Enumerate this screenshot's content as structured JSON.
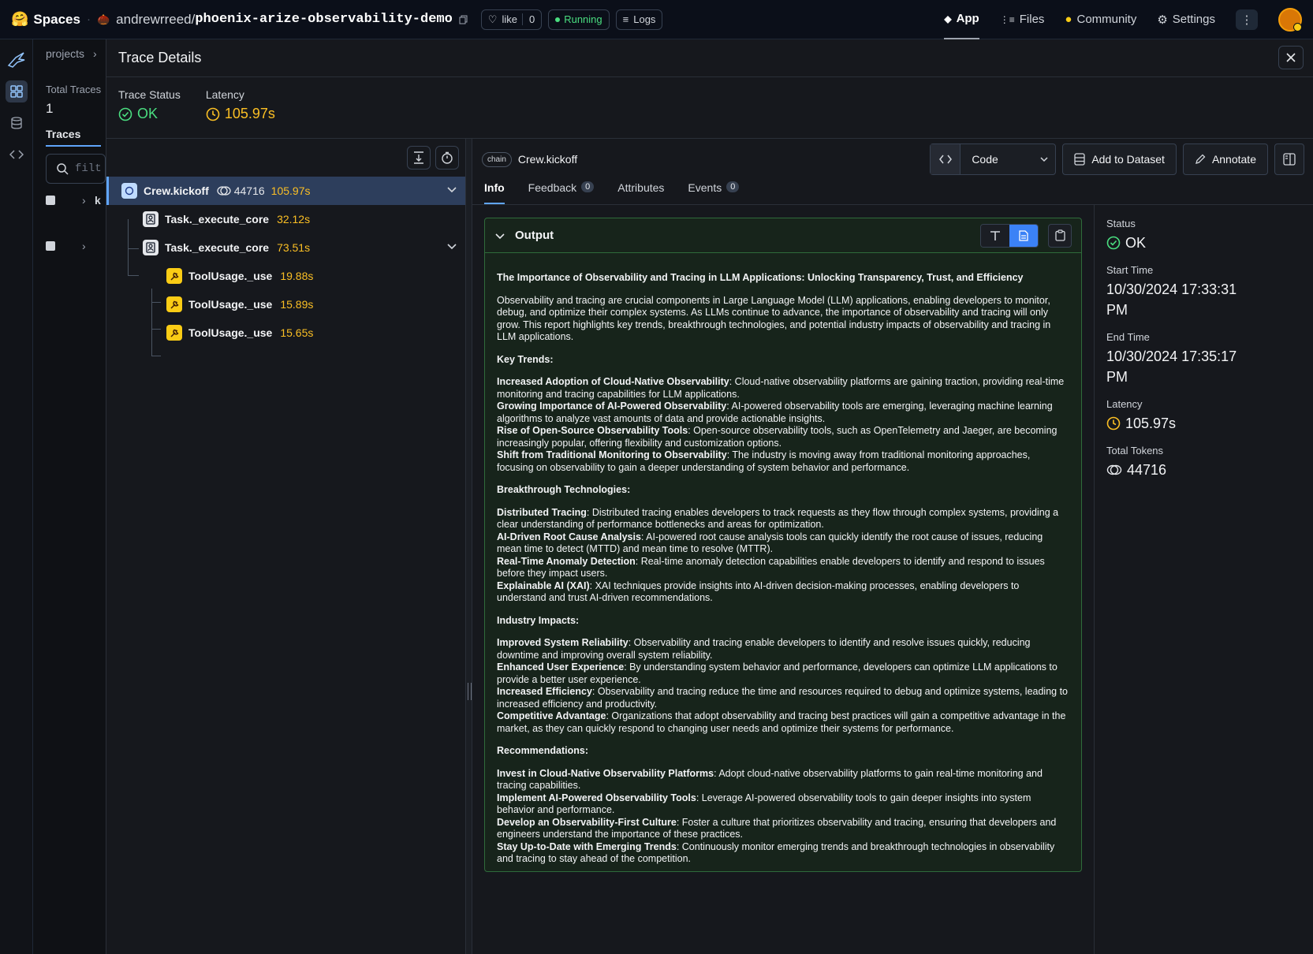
{
  "topbar": {
    "spaces_label": "Spaces",
    "repo_owner": "andrewrreed",
    "repo_slash": "/",
    "repo_name": "phoenix-arize-observability-demo",
    "like_label": "like",
    "like_count": "0",
    "status": "Running",
    "logs_label": "Logs",
    "nav": [
      "App",
      "Files",
      "Community",
      "Settings"
    ]
  },
  "bg": {
    "breadcrumb": "projects",
    "total_traces_label": "Total Traces",
    "total_traces_value": "1",
    "traces_tab": "Traces",
    "search_placeholder": "filt",
    "row_initial": "k"
  },
  "drawer": {
    "title": "Trace Details",
    "trace_status_label": "Trace Status",
    "trace_status_value": "OK",
    "latency_label": "Latency",
    "latency_value": "105.97s"
  },
  "tree": [
    {
      "name": "Crew.kickoff",
      "kind": "chain",
      "tokens": "44716",
      "latency": "105.97s"
    },
    {
      "name": "Task._execute_core",
      "kind": "agent",
      "latency": "32.12s"
    },
    {
      "name": "Task._execute_core",
      "kind": "agent",
      "latency": "73.51s"
    },
    {
      "name": "ToolUsage._use",
      "kind": "tool",
      "latency": "19.88s"
    },
    {
      "name": "ToolUsage._use",
      "kind": "tool",
      "latency": "15.89s"
    },
    {
      "name": "ToolUsage._use",
      "kind": "tool",
      "latency": "15.65s"
    }
  ],
  "span": {
    "badge": "chain",
    "name": "Crew.kickoff",
    "code_label": "Code",
    "add_dataset_label": "Add to Dataset",
    "annotate_label": "Annotate"
  },
  "tabs": [
    {
      "label": "Info"
    },
    {
      "label": "Feedback",
      "count": "0"
    },
    {
      "label": "Attributes"
    },
    {
      "label": "Events",
      "count": "0"
    }
  ],
  "output": {
    "title": "Output",
    "heading": "The Importance of Observability and Tracing in LLM Applications: Unlocking Transparency, Trust, and Efficiency",
    "intro": "Observability and tracing are crucial components in Large Language Model (LLM) applications, enabling developers to monitor, debug, and optimize their complex systems. As LLMs continue to advance, the importance of observability and tracing will only grow. This report highlights key trends, breakthrough technologies, and potential industry impacts of observability and tracing in LLM applications.",
    "sections": [
      {
        "title": "Key Trends:",
        "items": [
          {
            "b": "Increased Adoption of Cloud-Native Observability",
            "t": ": Cloud-native observability platforms are gaining traction, providing real-time monitoring and tracing capabilities for LLM applications."
          },
          {
            "b": "Growing Importance of AI-Powered Observability",
            "t": ": AI-powered observability tools are emerging, leveraging machine learning algorithms to analyze vast amounts of data and provide actionable insights."
          },
          {
            "b": "Rise of Open-Source Observability Tools",
            "t": ": Open-source observability tools, such as OpenTelemetry and Jaeger, are becoming increasingly popular, offering flexibility and customization options."
          },
          {
            "b": "Shift from Traditional Monitoring to Observability",
            "t": ": The industry is moving away from traditional monitoring approaches, focusing on observability to gain a deeper understanding of system behavior and performance."
          }
        ]
      },
      {
        "title": "Breakthrough Technologies:",
        "items": [
          {
            "b": "Distributed Tracing",
            "t": ": Distributed tracing enables developers to track requests as they flow through complex systems, providing a clear understanding of performance bottlenecks and areas for optimization."
          },
          {
            "b": "AI-Driven Root Cause Analysis",
            "t": ": AI-powered root cause analysis tools can quickly identify the root cause of issues, reducing mean time to detect (MTTD) and mean time to resolve (MTTR)."
          },
          {
            "b": "Real-Time Anomaly Detection",
            "t": ": Real-time anomaly detection capabilities enable developers to identify and respond to issues before they impact users."
          },
          {
            "b": "Explainable AI (XAI)",
            "t": ": XAI techniques provide insights into AI-driven decision-making processes, enabling developers to understand and trust AI-driven recommendations."
          }
        ]
      },
      {
        "title": "Industry Impacts:",
        "items": [
          {
            "b": "Improved System Reliability",
            "t": ": Observability and tracing enable developers to identify and resolve issues quickly, reducing downtime and improving overall system reliability."
          },
          {
            "b": "Enhanced User Experience",
            "t": ": By understanding system behavior and performance, developers can optimize LLM applications to provide a better user experience."
          },
          {
            "b": "Increased Efficiency",
            "t": ": Observability and tracing reduce the time and resources required to debug and optimize systems, leading to increased efficiency and productivity."
          },
          {
            "b": "Competitive Advantage",
            "t": ": Organizations that adopt observability and tracing best practices will gain a competitive advantage in the market, as they can quickly respond to changing user needs and optimize their systems for performance."
          }
        ]
      },
      {
        "title": "Recommendations:",
        "items": [
          {
            "b": "Invest in Cloud-Native Observability Platforms",
            "t": ": Adopt cloud-native observability platforms to gain real-time monitoring and tracing capabilities."
          },
          {
            "b": "Implement AI-Powered Observability Tools",
            "t": ": Leverage AI-powered observability tools to gain deeper insights into system behavior and performance."
          },
          {
            "b": "Develop an Observability-First Culture",
            "t": ": Foster a culture that prioritizes observability and tracing, ensuring that developers and engineers understand the importance of these practices."
          },
          {
            "b": "Stay Up-to-Date with Emerging Trends",
            "t": ": Continuously monitor emerging trends and breakthrough technologies in observability and tracing to stay ahead of the competition."
          }
        ]
      }
    ]
  },
  "side": {
    "status_label": "Status",
    "status_value": "OK",
    "start_label": "Start Time",
    "start_value": "10/30/2024 17:33:31 PM",
    "end_label": "End Time",
    "end_value": "10/30/2024 17:35:17 PM",
    "latency_label": "Latency",
    "latency_value": "105.97s",
    "tokens_label": "Total Tokens",
    "tokens_value": "44716"
  },
  "colors": {
    "ok": "#4ade80",
    "latency": "#fbbf24",
    "accent": "#60a5fa",
    "output_border": "#2f6b3b"
  }
}
